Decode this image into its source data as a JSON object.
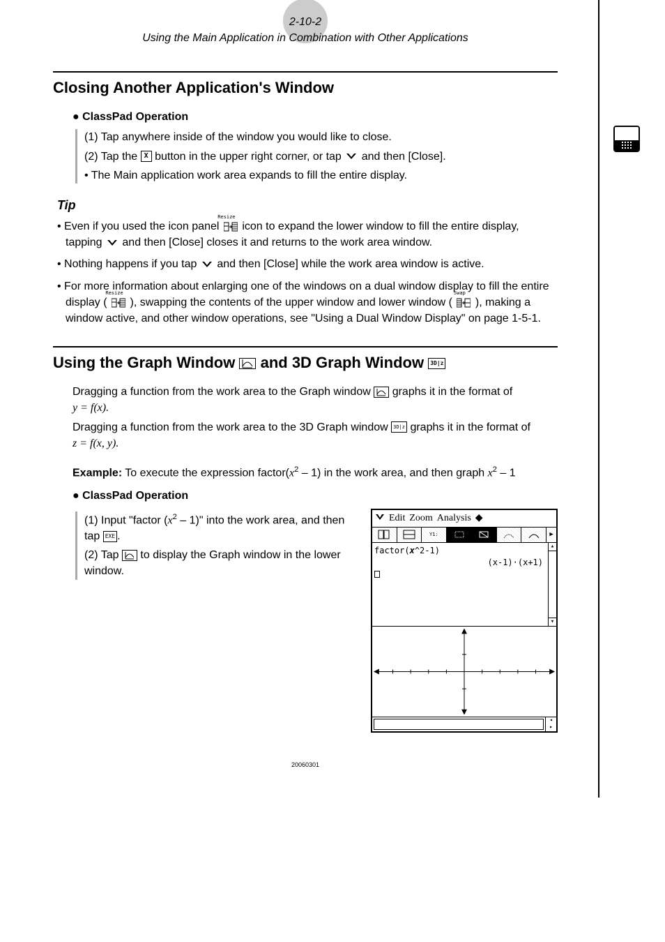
{
  "header": {
    "page_ref": "2-10-2",
    "subtitle": "Using the Main Application in Combination with Other Applications"
  },
  "section1": {
    "title": "Closing Another Application's Window",
    "op_head": "ClassPad Operation",
    "step1": "(1) Tap anywhere inside of the window you would like to close.",
    "step2_a": "(2) Tap the ",
    "step2_b": " button in the upper right corner, or tap ",
    "step2_c": " and then [Close].",
    "step2_note": "• The Main application work area expands to fill the entire display.",
    "tip_head": "Tip",
    "tip1_a": "Even if you used the icon panel ",
    "tip1_b": " icon to expand the lower window to fill the entire display, tapping ",
    "tip1_c": " and then [Close] closes it and returns to the work area window.",
    "tip2_a": "Nothing happens if you tap ",
    "tip2_b": " and then [Close] while the work area window is active.",
    "tip3_a": "For more information about enlarging one of the windows on a dual window display to fill the entire display (",
    "tip3_b": "), swapping the contents of the upper window and lower window (",
    "tip3_c": "), making a window active, and other window operations, see \"Using a Dual Window Display\" on page 1-5-1."
  },
  "section2": {
    "title_a": "Using the Graph Window ",
    "title_b": " and 3D Graph Window ",
    "p1_a": "Dragging a function from the work area to the Graph window ",
    "p1_b": " graphs it in the format of",
    "p1_eq": "y = f(x).",
    "p2_a": "Dragging a function from the work area to the 3D Graph window ",
    "p2_b": " graphs it in the format of",
    "p2_eq": "z = f(x, y).",
    "example_label": "Example:",
    "example_a": "  To execute the expression factor(",
    "example_b": " – 1) in the work area, and then graph ",
    "example_c": " – 1",
    "op_head": "ClassPad Operation",
    "step1_a": "(1)  Input \"factor (",
    "step1_b": " – 1)\" into the work area, and then tap ",
    "step1_c": ".",
    "step2_a": "(2)  Tap ",
    "step2_b": " to display the Graph window in the lower window."
  },
  "screenshot": {
    "menu": {
      "edit": "Edit",
      "zoom": "Zoom",
      "analysis": "Analysis",
      "arrow": "◆"
    },
    "work_line": "factor(x^2-1)",
    "work_result": "(x-1)·(x+1)"
  },
  "icons": {
    "close_x": "X",
    "vee": "❖",
    "resize_label": "Resize",
    "swap_label": "Swap",
    "exe": "EXE",
    "graph_3d": "3D|z"
  },
  "footer": "20060301"
}
